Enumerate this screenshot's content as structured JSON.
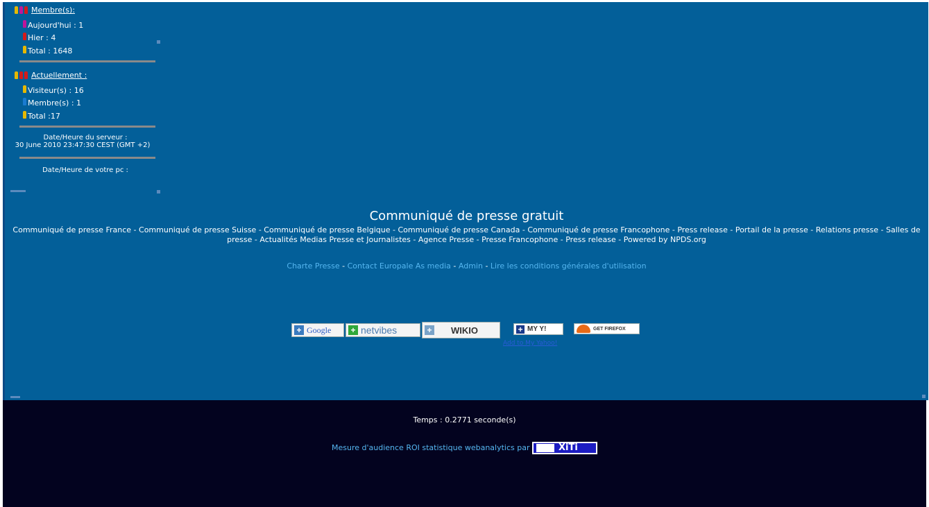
{
  "members": {
    "header": "Membre(s):",
    "today": "Aujourd'hui : 1",
    "yesterday": "Hier : 4",
    "total": "Total : 1648"
  },
  "current": {
    "header": "Actuellement :",
    "visitors": "Visiteur(s) : 16",
    "members": "Membre(s) : 1",
    "total": "Total :17"
  },
  "server_time": {
    "label": "Date/Heure du serveur :",
    "value": "30 June 2010 23:47:30 CEST (GMT +2)"
  },
  "pc_time": {
    "label": "Date/Heure de votre pc :"
  },
  "site": {
    "title": "Communiqué de presse gratuit",
    "tagline": "Communiqué de presse France - Communiqué de presse Suisse - Communiqué de presse Belgique - Communiqué de presse Canada - Communiqué de presse Francophone - Press release - Portail de la presse - Relations presse - Salles de presse - Actualités Medias Presse et Journalistes - Agence Presse - Presse Francophone - Press release - Powered by NPDS.org"
  },
  "links": {
    "charte": "Charte Presse",
    "contact": "Contact Europale As media",
    "admin": "Admin",
    "cgu": "Lire les conditions générales d'utilisation",
    "sep": "-"
  },
  "buttons": {
    "google": "Google",
    "netvibes": "netvibes",
    "wikio": "WIKIO",
    "myyahoo": "MY Y!",
    "add_yahoo": "Add to My Yahoo!",
    "firefox": "GET FIREFOX"
  },
  "footer": {
    "time": "Temps : 0.2771 seconde(s)",
    "audience": "Mesure d'audience ROI statistique webanalytics par",
    "xiti": "XiTi"
  },
  "colors": {
    "main_bg": "#035f99",
    "footer_bg": "#03031f",
    "link": "#55b6f0"
  }
}
